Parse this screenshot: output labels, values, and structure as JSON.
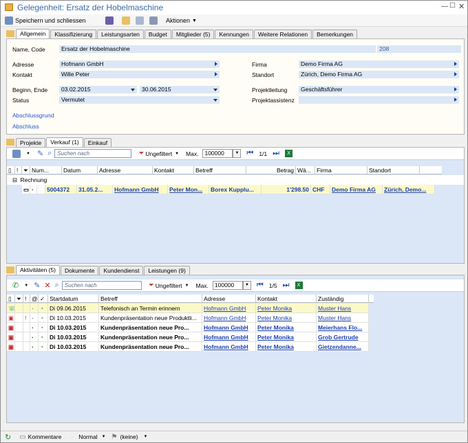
{
  "window": {
    "title": "Gelegenheit: Ersatz der Hobelmaschine"
  },
  "toolbar": {
    "save_close": "Speichern und schliessen",
    "actions": "Aktionen"
  },
  "main_tabs": [
    "Allgemein",
    "Klassifizierung",
    "Leistungsarten",
    "Budget",
    "Mitglieder (5)",
    "Kennungen",
    "Weitere Relationen",
    "Bemerkungen"
  ],
  "form": {
    "name_label": "Name, Code",
    "name_value": "Ersatz der Hobelmaschine",
    "code_value": "208",
    "adresse_label": "Adresse",
    "adresse_value": "Hofmann GmbH",
    "kontakt_label": "Kontakt",
    "kontakt_value": "Wille Peter",
    "firma_label": "Firma",
    "firma_value": "Demo Firma AG",
    "standort_label": "Standort",
    "standort_value": "Zürich, Demo Firma AG",
    "beginn_label": "Beginn, Ende",
    "beginn_value": "03.02.2015",
    "ende_value": "30.06.2015",
    "status_label": "Status",
    "status_value": "Vermutet",
    "projektleitung_label": "Projektleitung",
    "projektleitung_value": "Geschäftsführer",
    "projektassistenz_label": "Projektassistenz",
    "projektassistenz_value": "",
    "abschlussgrund": "Abschlussgrund",
    "abschluss": "Abschluss"
  },
  "mid_tabs": [
    "Projekte",
    "Verkauf (1)",
    "Einkauf"
  ],
  "grid1": {
    "search_placeholder": "Suchen nach",
    "filter": "Ungefiltert",
    "max_label": "Max.",
    "max_value": "100000",
    "page": "1/1",
    "columns": [
      "Num...",
      "Datum",
      "Adresse",
      "Kontakt",
      "Betreff",
      "Betrag",
      "Wä...",
      "Firma",
      "Standort"
    ],
    "group": "Rechnung",
    "rows": [
      [
        "5004372",
        "31.05.2...",
        "Hofmann GmbH",
        "Peter Mon...",
        "Borex Kupplu...",
        "1'298.50",
        "CHF",
        "Demo Firma AG",
        "Zürich, Demo..."
      ]
    ]
  },
  "bottom_tabs": [
    "Aktivitäten (5)",
    "Dokumente",
    "Kundendienst",
    "Leistungen (9)"
  ],
  "grid2": {
    "search_placeholder": "Suchen nach",
    "filter": "Ungefiltert",
    "max_label": "Max.",
    "max_value": "100000",
    "page": "1/5",
    "columns": [
      "Startdatum",
      "Betreff",
      "Adresse",
      "Kontakt",
      "Zuständig"
    ],
    "rows": [
      {
        "date": "Di 09.06.2015",
        "betreff": "Telefonisch an Termin erinnern",
        "adresse": "Hofmann GmbH",
        "kontakt": "Peter Monika",
        "zust": "Muster Hans",
        "bold": false,
        "excl": "",
        "bg": "yellow"
      },
      {
        "date": "Di 10.03.2015",
        "betreff": "Kundenpräsentation neue Produktli...",
        "adresse": "Hofmann GmbH",
        "kontakt": "Peter Monika",
        "zust": "Muster Hans",
        "bold": false,
        "excl": "!",
        "bg": "blue"
      },
      {
        "date": "Di 10.03.2015",
        "betreff": "Kundenpräsentation neue Pro...",
        "adresse": "Hofmann GmbH",
        "kontakt": "Peter Monika",
        "zust": "Meierhans Flo...",
        "bold": true,
        "excl": "",
        "bg": "blue"
      },
      {
        "date": "Di 10.03.2015",
        "betreff": "Kundenpräsentation neue Pro...",
        "adresse": "Hofmann GmbH",
        "kontakt": "Peter Monika",
        "zust": "Grob Gertrude",
        "bold": true,
        "excl": "",
        "bg": "blue"
      },
      {
        "date": "Di 10.03.2015",
        "betreff": "Kundenpräsentation neue Pro...",
        "adresse": "Hofmann GmbH",
        "kontakt": "Peter Monika",
        "zust": "Gietzendanne...",
        "bold": true,
        "excl": "",
        "bg": "blue"
      }
    ]
  },
  "statusbar": {
    "comments": "Kommentare",
    "priority": "Normal",
    "flag": "(keine)"
  }
}
